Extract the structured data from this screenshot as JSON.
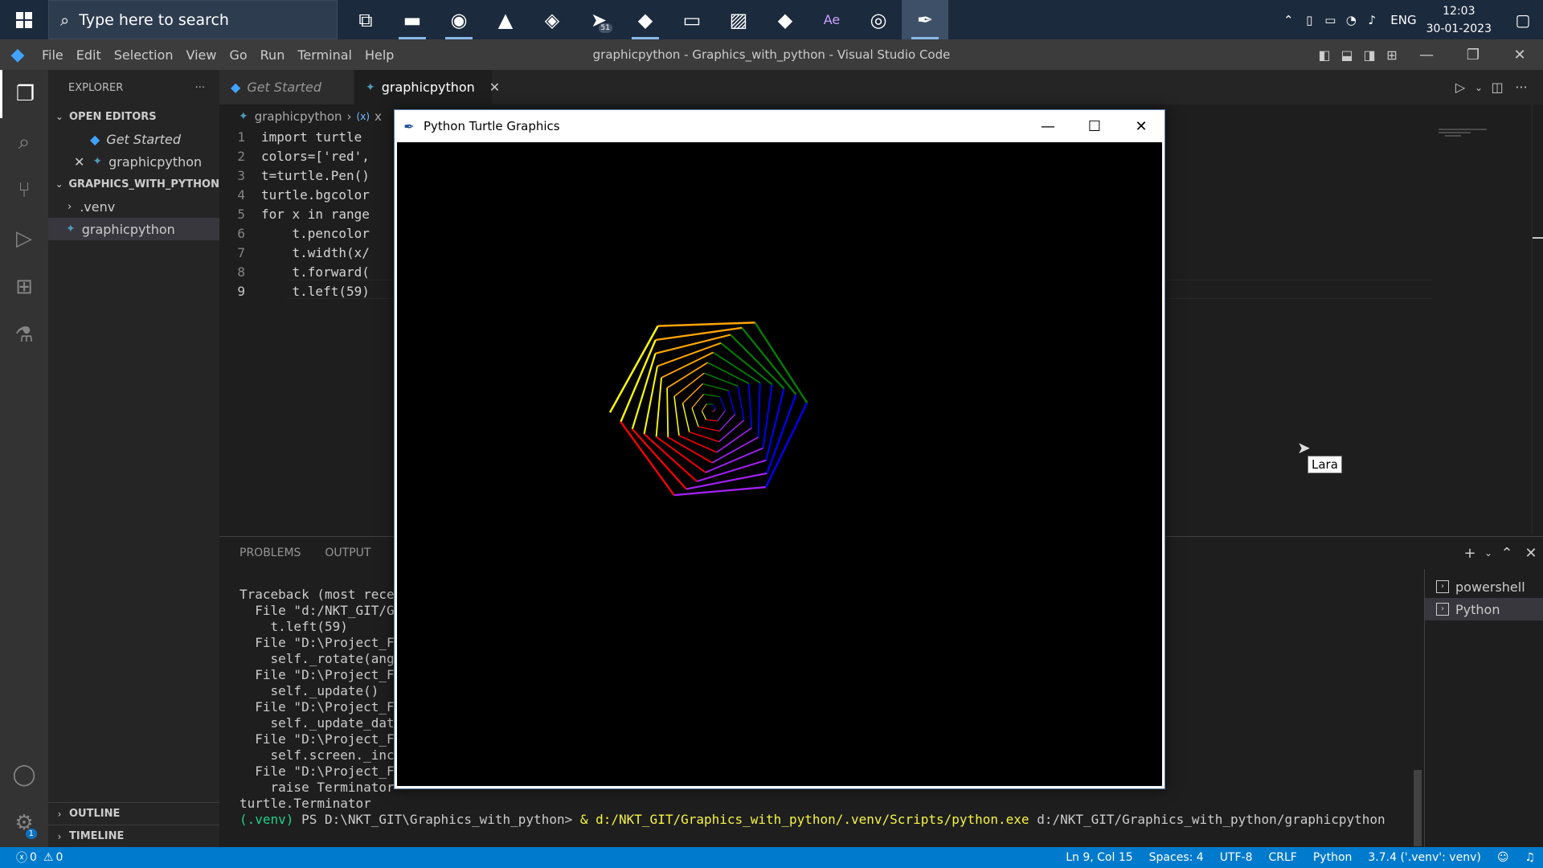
{
  "taskbar": {
    "search_placeholder": "Type here to search",
    "apps": [
      {
        "name": "task-view-icon",
        "glyph": "⧉",
        "open": false
      },
      {
        "name": "file-explorer-icon",
        "glyph": "▬",
        "open": true
      },
      {
        "name": "firefox-icon",
        "glyph": "◉",
        "open": true
      },
      {
        "name": "vlc-icon",
        "glyph": "▲",
        "open": false
      },
      {
        "name": "nvidia-icon",
        "glyph": "◈",
        "open": false
      },
      {
        "name": "telegram-icon",
        "glyph": "➤",
        "open": false,
        "badge": "51"
      },
      {
        "name": "vscode-icon",
        "glyph": "◆",
        "open": true
      },
      {
        "name": "terminal-icon",
        "glyph": "▭",
        "open": false
      },
      {
        "name": "photos-icon",
        "glyph": "▨",
        "open": false
      },
      {
        "name": "anydesk-icon",
        "glyph": "◆",
        "open": false
      },
      {
        "name": "after-effects-icon",
        "glyph": "Ae",
        "open": false
      },
      {
        "name": "ubuntu-icon",
        "glyph": "◎",
        "open": false
      },
      {
        "name": "python-turtle-icon",
        "glyph": "✒",
        "open": true,
        "active": true
      }
    ],
    "tray": {
      "lang": "ENG",
      "time": "12:03",
      "date": "30-01-2023"
    }
  },
  "titlebar": {
    "menu": [
      "File",
      "Edit",
      "Selection",
      "View",
      "Go",
      "Run",
      "Terminal",
      "Help"
    ],
    "title": "graphicpython - Graphics_with_python - Visual Studio Code"
  },
  "sidebar": {
    "header": "EXPLORER",
    "open_editors_label": "OPEN EDITORS",
    "open_editors": [
      "Get Started",
      "graphicpython"
    ],
    "folder_label": "GRAPHICS_WITH_PYTHON",
    "folder_items": [
      ".venv",
      "graphicpython"
    ],
    "outline_label": "OUTLINE",
    "timeline_label": "TIMELINE"
  },
  "tabs": [
    {
      "label": "Get Started",
      "active": false
    },
    {
      "label": "graphicpython",
      "active": true
    }
  ],
  "breadcrumb": [
    "graphicpython",
    "x"
  ],
  "code": {
    "line_numbers": [
      "1",
      "2",
      "3",
      "4",
      "5",
      "6",
      "7",
      "8",
      "9"
    ],
    "lines": [
      "import turtle",
      "colors=['red',",
      "t=turtle.Pen()",
      "turtle.bgcolor",
      "for x in range",
      "    t.pencolor",
      "    t.width(x/",
      "    t.forward(",
      "    t.left(59)"
    ],
    "current_line": 9
  },
  "panel": {
    "tabs": [
      "PROBLEMS",
      "OUTPUT",
      "DE"
    ],
    "terminal_lines": [
      "Traceback (most recen",
      "  File \"d:/NKT_GIT/Gr",
      "    t.left(59)",
      "  File \"D:\\Project_Fi",
      "    self._rotate(angl",
      "  File \"D:\\Project_Fi",
      "    self._update()",
      "  File \"D:\\Project_Fi",
      "    self._update_data",
      "  File \"D:\\Project_Fi",
      "    self.screen._incr",
      "  File \"D:\\Project_Fi",
      "    raise Terminator",
      "turtle.Terminator"
    ],
    "prompt_venv": "(.venv)",
    "prompt_path": " PS D:\\NKT_GIT\\Graphics_with_python> ",
    "prompt_amp": "& ",
    "prompt_exe": "d:/NKT_GIT/Graphics_with_python/.venv/Scripts/python.exe",
    "prompt_arg": " d:/NKT_GIT/Graphics_with_python/graphicpython",
    "terminals": [
      "powershell",
      "Python"
    ]
  },
  "statusbar": {
    "errors": "0",
    "warnings": "0",
    "position": "Ln 9, Col 15",
    "spaces": "Spaces: 4",
    "encoding": "UTF-8",
    "eol": "CRLF",
    "language": "Python",
    "interpreter": "3.7.4 ('.venv': venv)"
  },
  "turtle_window": {
    "title": "Python Turtle Graphics",
    "spiral_colors": [
      "#ff0000",
      "#a020f0",
      "#0000ff",
      "#008000",
      "#ffa500",
      "#ffff00"
    ],
    "turn_degrees": 59,
    "segments": 60
  },
  "tooltip": "Lara"
}
